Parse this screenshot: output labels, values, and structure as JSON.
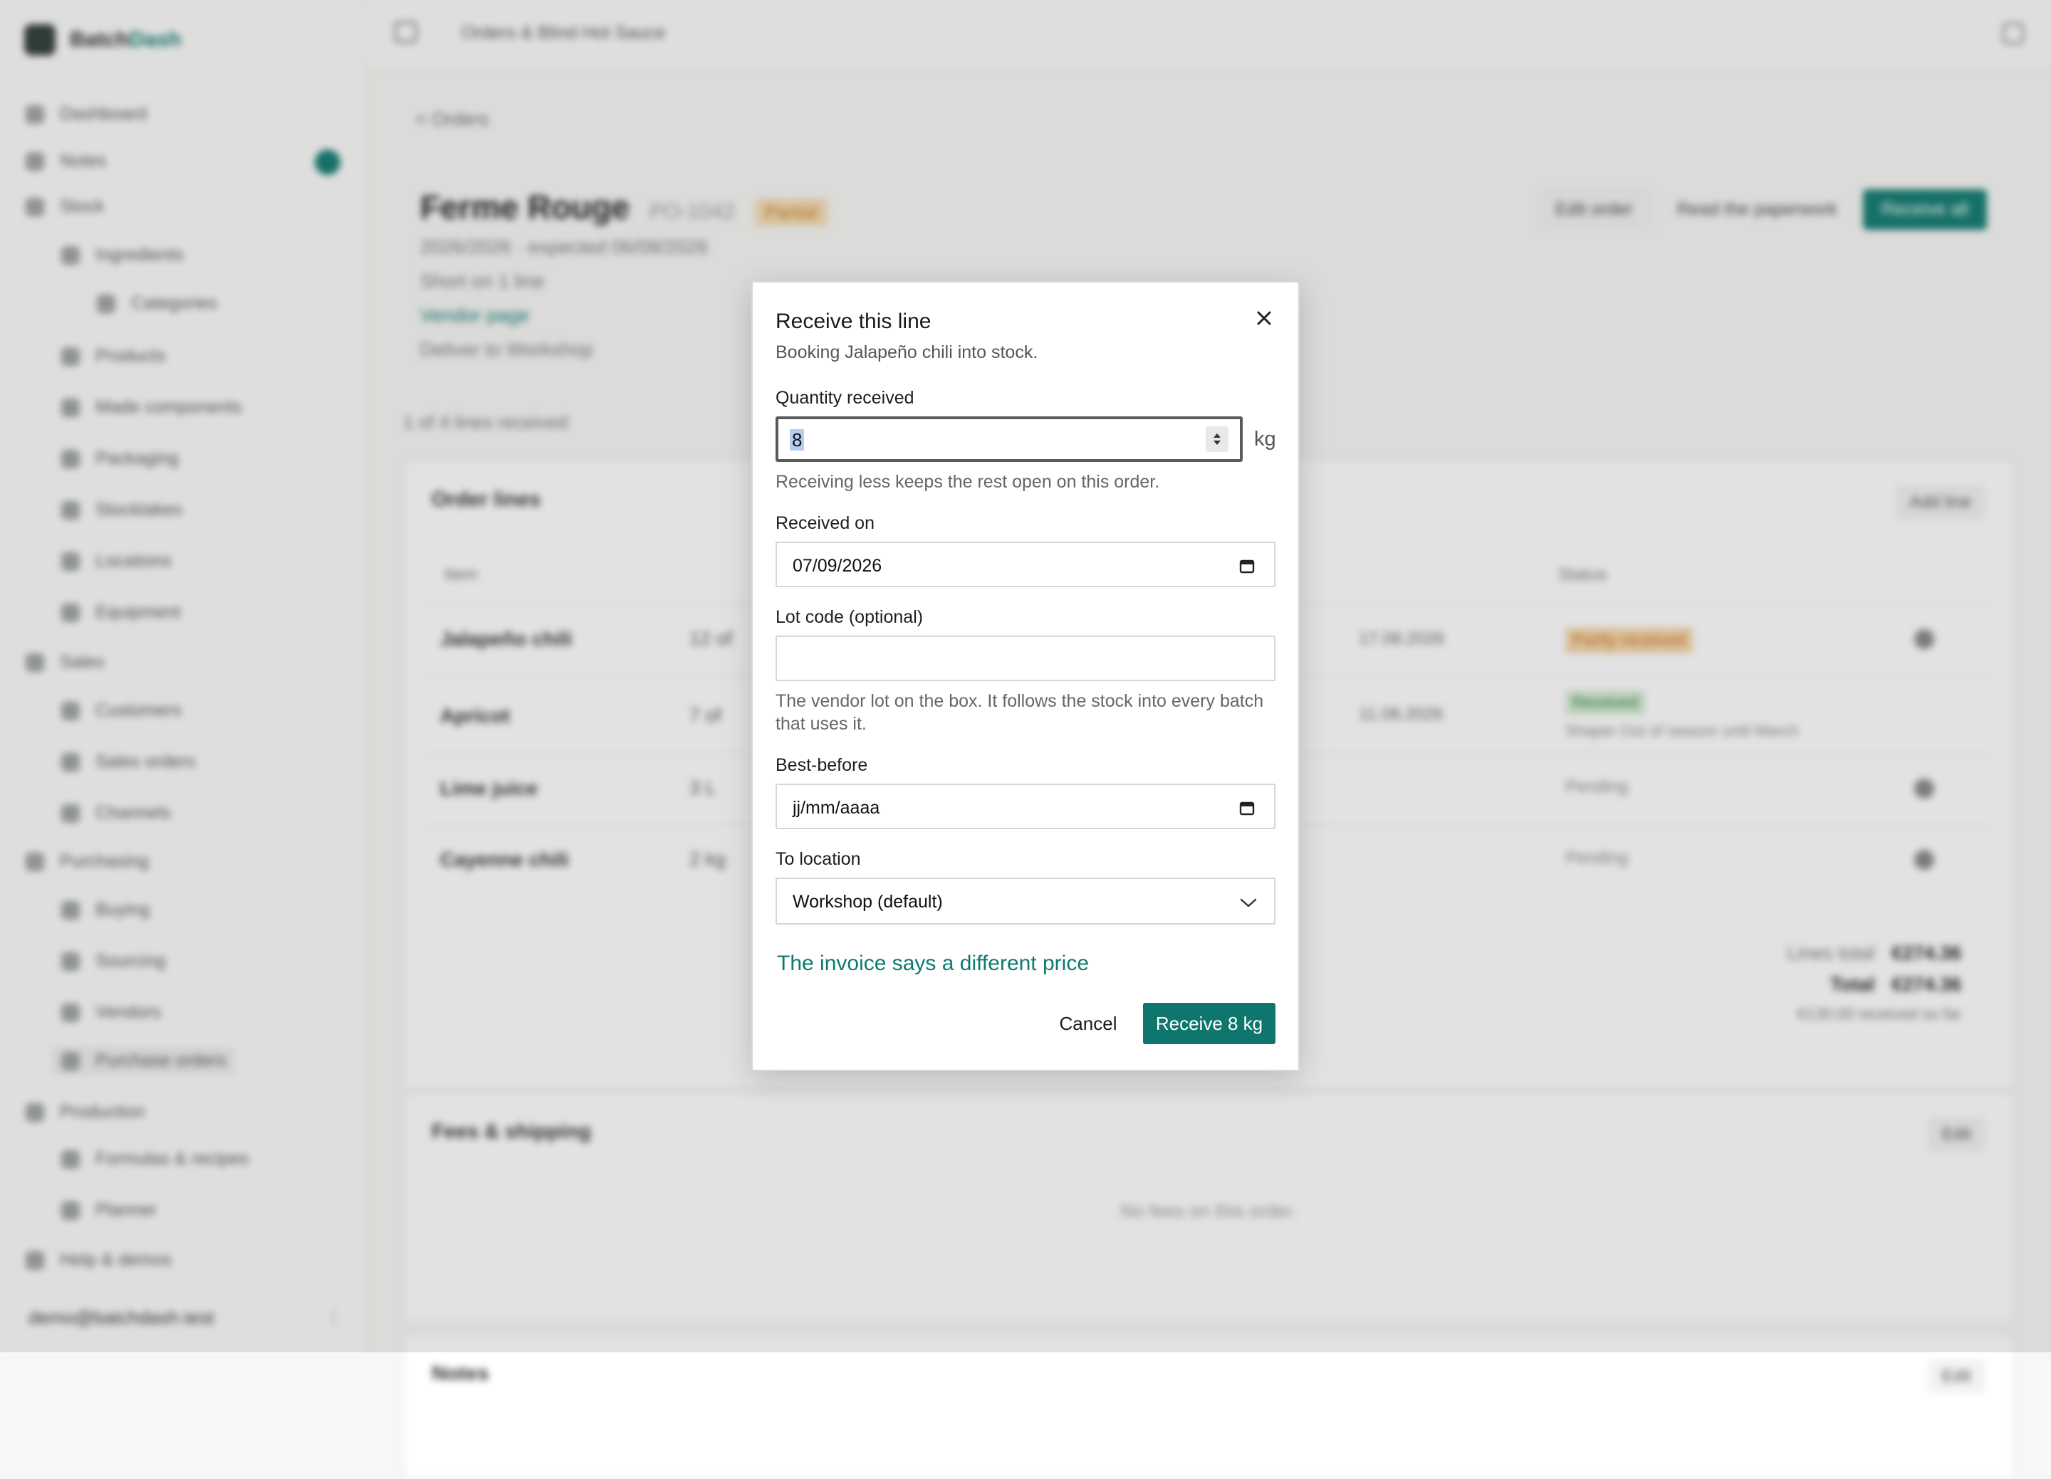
{
  "app": {
    "brand_prefix": "Batch",
    "brand_accent": "Dash",
    "breadcrumb": "Orders & Blind Hot Sauce",
    "sidebar": {
      "items": [
        {
          "label": "Dashboard"
        },
        {
          "label": "Notes"
        },
        {
          "label": "Stock"
        },
        {
          "label": "Ingredients"
        },
        {
          "label": "Categories"
        },
        {
          "label": "Products"
        },
        {
          "label": "Made components"
        },
        {
          "label": "Packaging"
        },
        {
          "label": "Stocktakes"
        },
        {
          "label": "Locations"
        },
        {
          "label": "Equipment"
        },
        {
          "label": "Sales"
        },
        {
          "label": "Customers"
        },
        {
          "label": "Sales orders"
        },
        {
          "label": "Channels"
        },
        {
          "label": "Purchasing"
        },
        {
          "label": "Buying"
        },
        {
          "label": "Sourcing"
        },
        {
          "label": "Vendors"
        },
        {
          "label": "Purchase orders"
        },
        {
          "label": "Production"
        },
        {
          "label": "Formulas & recipes"
        },
        {
          "label": "Planner"
        },
        {
          "label": "Help & demos"
        }
      ],
      "user": "demo@batchdash.test",
      "user_menu": "⋮"
    },
    "order": {
      "back": "< Orders",
      "vendor": "Ferme Rouge",
      "po": "PO-1042",
      "status": "Partial",
      "dates": "2026/2026 · expected 06/08/2026",
      "short": "Short on 1 line",
      "vendor_link": "Vendor page",
      "deliver": "Deliver to Workshop",
      "actions": {
        "edit": "Edit order",
        "read": "Read the paperwork",
        "receive_all": "Receive all"
      },
      "received_count": "1 of 4 lines received",
      "lines_title": "Order lines",
      "add_line": "Add line",
      "col_item": "Item",
      "col_status": "Status",
      "lines": [
        {
          "name": "Jalapeño chili",
          "qty": "12 of",
          "date": "17.08.2026",
          "status": "Partly received",
          "note": ""
        },
        {
          "name": "Apricot",
          "qty": "7 of",
          "date": "11.08.2026",
          "status": "Received",
          "note": "Shaper Out of season until March"
        },
        {
          "name": "Lime juice",
          "qty": "3 L",
          "date": "",
          "status": "Pending",
          "note": ""
        },
        {
          "name": "Cayenne chili",
          "qty": "2 kg",
          "date": "",
          "status": "Pending",
          "note": ""
        }
      ],
      "lines_total_label": "Lines total",
      "lines_total": "€274.36",
      "total_label": "Total",
      "total": "€274.36",
      "received_so_far": "€130.00 received so far",
      "fees_title": "Fees & shipping",
      "fees_edit": "Edit",
      "fees_empty": "No fees on this order.",
      "notes_title": "Notes",
      "notes_edit": "Edit"
    }
  },
  "modal": {
    "title": "Receive this line",
    "subtitle": "Booking Jalapeño chili into stock.",
    "quantity": {
      "label": "Quantity received",
      "value": "8",
      "unit": "kg",
      "help": "Receiving less keeps the rest open on this order."
    },
    "received_on": {
      "label": "Received on",
      "value": "07/09/2026"
    },
    "lot_code": {
      "label": "Lot code (optional)",
      "value": "",
      "help": "The vendor lot on the box. It follows the stock into every batch that uses it."
    },
    "best_before": {
      "label": "Best-before",
      "value": "jj/mm/aaaa"
    },
    "location": {
      "label": "To location",
      "value": "Workshop (default)"
    },
    "price_link": "The invoice says a different price",
    "cancel": "Cancel",
    "submit": "Receive 8 kg"
  },
  "colors": {
    "accent": "#0f766e",
    "partial_badge": "#f6d6ad"
  }
}
